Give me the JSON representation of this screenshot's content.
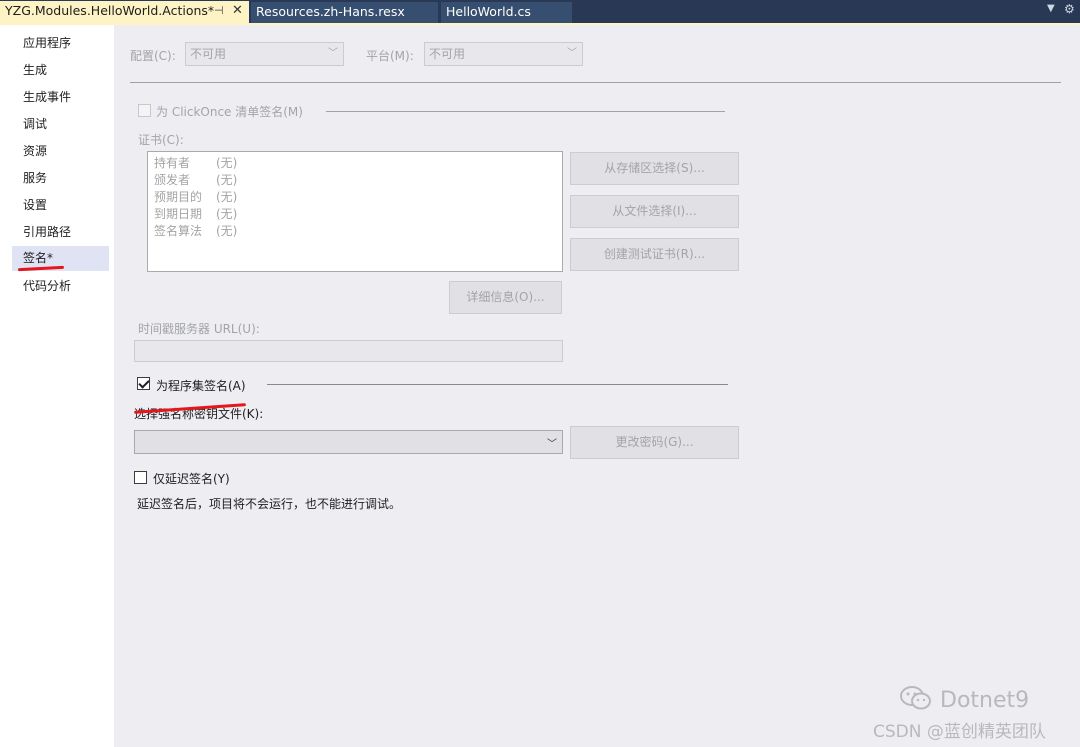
{
  "tabs": {
    "active": {
      "label": "YZG.Modules.HelloWorld.Actions*",
      "pin": "⊣",
      "close": "✕"
    },
    "others": [
      {
        "label": "Resources.zh-Hans.resx"
      },
      {
        "label": "HelloWorld.cs"
      }
    ],
    "overflow_icon": "dropdown-icon",
    "settings_icon": "gear-icon"
  },
  "sidebar": {
    "items": [
      {
        "label": "应用程序"
      },
      {
        "label": "生成"
      },
      {
        "label": "生成事件"
      },
      {
        "label": "调试"
      },
      {
        "label": "资源"
      },
      {
        "label": "服务"
      },
      {
        "label": "设置"
      },
      {
        "label": "引用路径"
      },
      {
        "label": "签名*",
        "selected": true
      },
      {
        "label": "代码分析"
      }
    ]
  },
  "config": {
    "config_label": "配置(C):",
    "config_value": "不可用",
    "platform_label": "平台(M):",
    "platform_value": "不可用"
  },
  "clickonce": {
    "checkbox_label": "为 ClickOnce 清单签名(M)",
    "checked": false,
    "cert_label": "证书(C):",
    "cert_rows": [
      {
        "key": "持有者",
        "value": "(无)"
      },
      {
        "key": "颁发者",
        "value": "(无)"
      },
      {
        "key": "预期目的",
        "value": "(无)"
      },
      {
        "key": "到期日期",
        "value": "(无)"
      },
      {
        "key": "签名算法",
        "value": "(无)"
      }
    ],
    "btn_store": "从存储区选择(S)...",
    "btn_file": "从文件选择(I)...",
    "btn_test": "创建测试证书(R)...",
    "btn_details": "详细信息(O)...",
    "timestamp_label": "时间戳服务器 URL(U):",
    "timestamp_value": ""
  },
  "assembly": {
    "checkbox_label": "为程序集签名(A)",
    "checked": true,
    "keyfile_label": "选择强名称密钥文件(K):",
    "keyfile_value": "",
    "btn_change_password": "更改密码(G)...",
    "delay_label": "仅延迟签名(Y)",
    "delay_checked": false,
    "delay_note": "延迟签名后，项目将不会运行，也不能进行调试。"
  },
  "watermark": {
    "line1": "Dotnet9",
    "line2": "CSDN @蓝创精英团队"
  }
}
